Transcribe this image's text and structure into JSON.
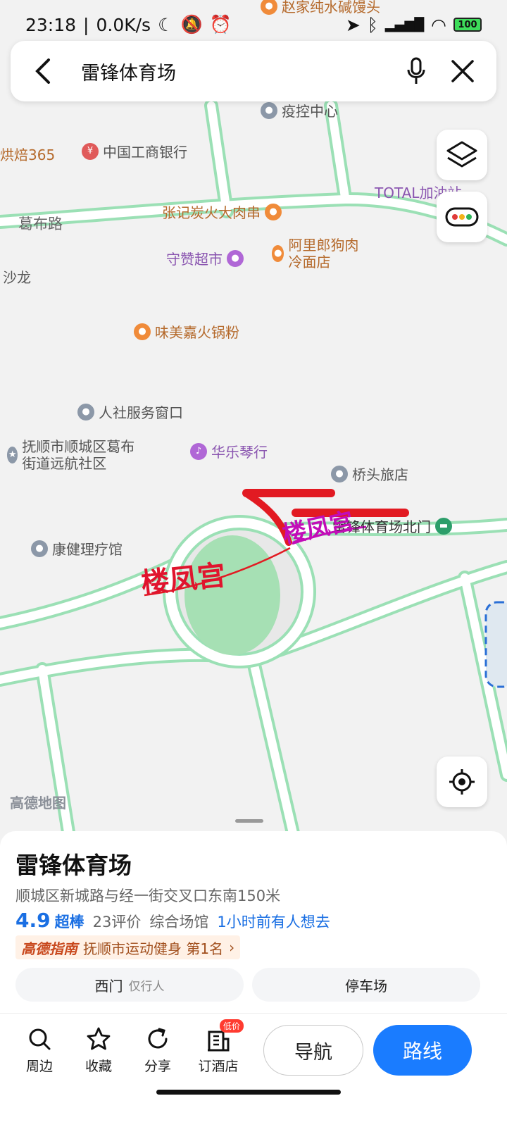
{
  "status_bar": {
    "time": "23:18",
    "speed": "0.0K/s",
    "battery": "100",
    "icons": [
      "moon-icon",
      "mute-icon",
      "alarm-icon",
      "location-icon",
      "bluetooth-icon",
      "signal-icon",
      "wifi-icon",
      "battery-icon"
    ]
  },
  "search": {
    "query": "雷锋体育场",
    "icons": [
      "back-icon",
      "mic-icon",
      "close-icon"
    ]
  },
  "map": {
    "buttons": [
      "layers-icon",
      "traffic-icon",
      "locate-icon"
    ],
    "road_labels": [
      "葛布路"
    ],
    "pois": [
      {
        "name": "赵家纯水碱馒头",
        "kind": "orange"
      },
      {
        "name": "疫控中心",
        "kind": "gray"
      },
      {
        "name": "烘焙365",
        "kind": "orange"
      },
      {
        "name": "中国工商银行",
        "kind": "gray"
      },
      {
        "name": "TOTAL加油站",
        "kind": "purple"
      },
      {
        "name": "张记炭火大肉串",
        "kind": "orange"
      },
      {
        "name": "守赞超市",
        "kind": "purple"
      },
      {
        "name": "阿里郎狗肉冷面店",
        "kind": "orange"
      },
      {
        "name": "沙龙",
        "kind": "gray"
      },
      {
        "name": "味美嘉火锅粉",
        "kind": "orange"
      },
      {
        "name": "人社服务窗口",
        "kind": "gray"
      },
      {
        "name": "抚顺市顺城区葛布街道远航社区",
        "kind": "gray"
      },
      {
        "name": "华乐琴行",
        "kind": "purple"
      },
      {
        "name": "桥头旅店",
        "kind": "gray"
      },
      {
        "name": "雷锋体育场北门",
        "kind": "gray"
      },
      {
        "name": "康健理疗馆",
        "kind": "gray"
      }
    ],
    "annotations": [
      "楼凤宫",
      "楼凤宫"
    ],
    "logo": "高德地图"
  },
  "place": {
    "name": "雷锋体育场",
    "address": "顺城区新城路与经一街交叉口东南150米",
    "rating": "4.9",
    "rating_label": "超棒",
    "reviews": "23评价",
    "category": "综合场馆",
    "recent": "1小时前有人想去",
    "guide_brand": "高德指南",
    "guide_text": "抚顺市运动健身 第1名",
    "chips": [
      {
        "label": "西门",
        "sub": "仅行人"
      },
      {
        "label": "停车场",
        "sub": ""
      }
    ]
  },
  "actions": {
    "nearby": "周边",
    "favorite": "收藏",
    "share": "分享",
    "hotel": "订酒店",
    "hotel_badge": "低价",
    "navigate": "导航",
    "route": "路线"
  }
}
